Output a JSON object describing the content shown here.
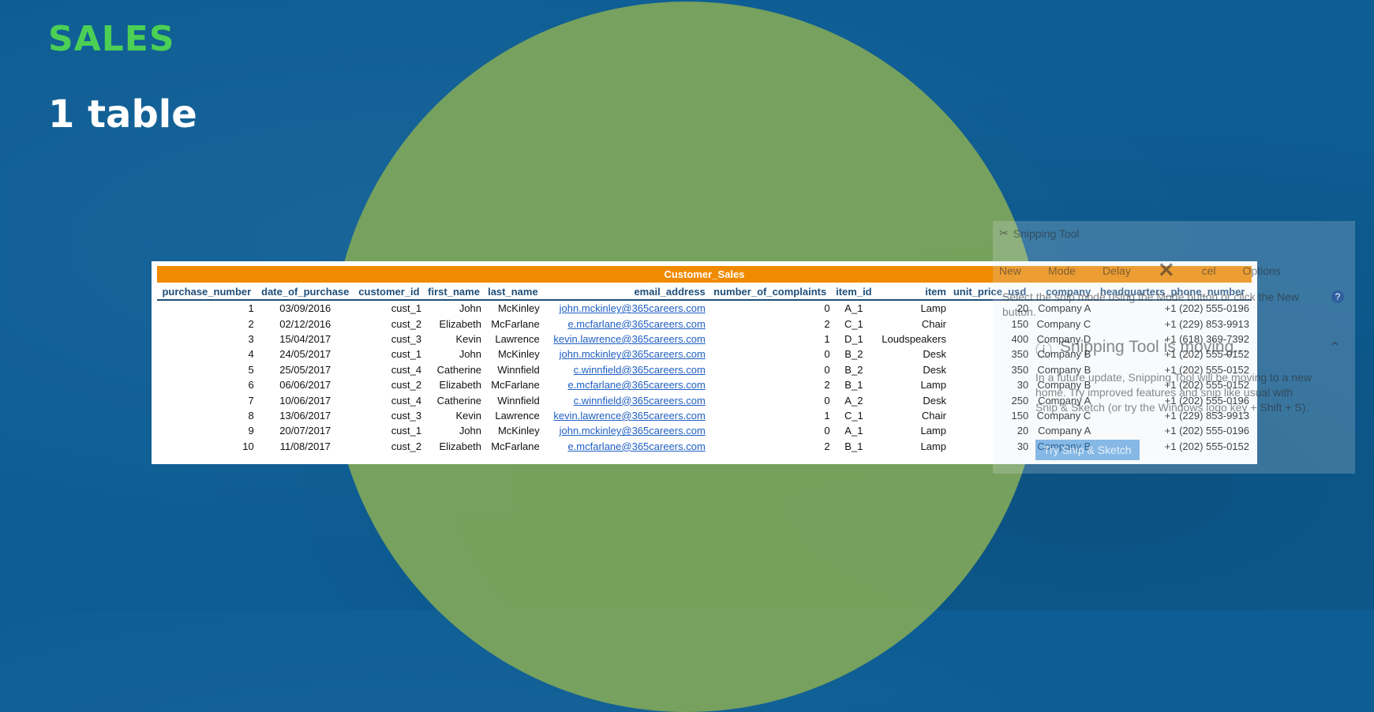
{
  "slide": {
    "title": "SALES",
    "subtitle": "1 table"
  },
  "colors": {
    "background": "#0d5d94",
    "circle": "#7aa35c",
    "title_green": "#4ccf55",
    "header_orange": "#f08a00",
    "header_text": "#1f4e79",
    "link_blue": "#1f5fc4"
  },
  "sheet": {
    "title": "Customer_Sales",
    "columns": [
      "purchase_number",
      "date_of_purchase",
      "customer_id",
      "first_name",
      "last_name",
      "email_address",
      "number_of_complaints",
      "item_id",
      "item",
      "unit_price_usd",
      "company",
      "headquarters_phone_number"
    ],
    "rows": [
      [
        "1",
        "03/09/2016",
        "cust_1",
        "John",
        "McKinley",
        "john.mckinley@365careers.com",
        "0",
        "A_1",
        "Lamp",
        "20",
        "Company A",
        "+1 (202) 555-0196"
      ],
      [
        "2",
        "02/12/2016",
        "cust_2",
        "Elizabeth",
        "McFarlane",
        "e.mcfarlane@365careers.com",
        "2",
        "C_1",
        "Chair",
        "150",
        "Company C",
        "+1 (229) 853-9913"
      ],
      [
        "3",
        "15/04/2017",
        "cust_3",
        "Kevin",
        "Lawrence",
        "kevin.lawrence@365careers.com",
        "1",
        "D_1",
        "Loudspeakers",
        "400",
        "Company D",
        "+1 (618) 369-7392"
      ],
      [
        "4",
        "24/05/2017",
        "cust_1",
        "John",
        "McKinley",
        "john.mckinley@365careers.com",
        "0",
        "B_2",
        "Desk",
        "350",
        "Company B",
        "+1 (202) 555-0152"
      ],
      [
        "5",
        "25/05/2017",
        "cust_4",
        "Catherine",
        "Winnfield",
        "c.winnfield@365careers.com",
        "0",
        "B_2",
        "Desk",
        "350",
        "Company B",
        "+1 (202) 555-0152"
      ],
      [
        "6",
        "06/06/2017",
        "cust_2",
        "Elizabeth",
        "McFarlane",
        "e.mcfarlane@365careers.com",
        "2",
        "B_1",
        "Lamp",
        "30",
        "Company B",
        "+1 (202) 555-0152"
      ],
      [
        "7",
        "10/06/2017",
        "cust_4",
        "Catherine",
        "Winnfield",
        "c.winnfield@365careers.com",
        "0",
        "A_2",
        "Desk",
        "250",
        "Company A",
        "+1 (202) 555-0196"
      ],
      [
        "8",
        "13/06/2017",
        "cust_3",
        "Kevin",
        "Lawrence",
        "kevin.lawrence@365careers.com",
        "1",
        "C_1",
        "Chair",
        "150",
        "Company C",
        "+1 (229) 853-9913"
      ],
      [
        "9",
        "20/07/2017",
        "cust_1",
        "John",
        "McKinley",
        "john.mckinley@365careers.com",
        "0",
        "A_1",
        "Lamp",
        "20",
        "Company A",
        "+1 (202) 555-0196"
      ],
      [
        "10",
        "11/08/2017",
        "cust_2",
        "Elizabeth",
        "McFarlane",
        "e.mcfarlane@365careers.com",
        "2",
        "B_1",
        "Lamp",
        "30",
        "Company B",
        "+1 (202) 555-0152"
      ]
    ]
  },
  "snipping_tool": {
    "title": "Snipping Tool",
    "toolbar": {
      "new": "New",
      "mode": "Mode",
      "delay": "Delay",
      "cancel": "cel",
      "options": "Options"
    },
    "tip": "Select the snip mode using the Mode button or click the New button.",
    "moving_title": "Snipping Tool is moving...",
    "moving_body": "In a future update, Snipping Tool will be moving to a new home. Try improved features and snip like usual with Snip & Sketch (or try the Windows logo key + Shift + S).",
    "try_button": "Try Snip & Sketch"
  }
}
